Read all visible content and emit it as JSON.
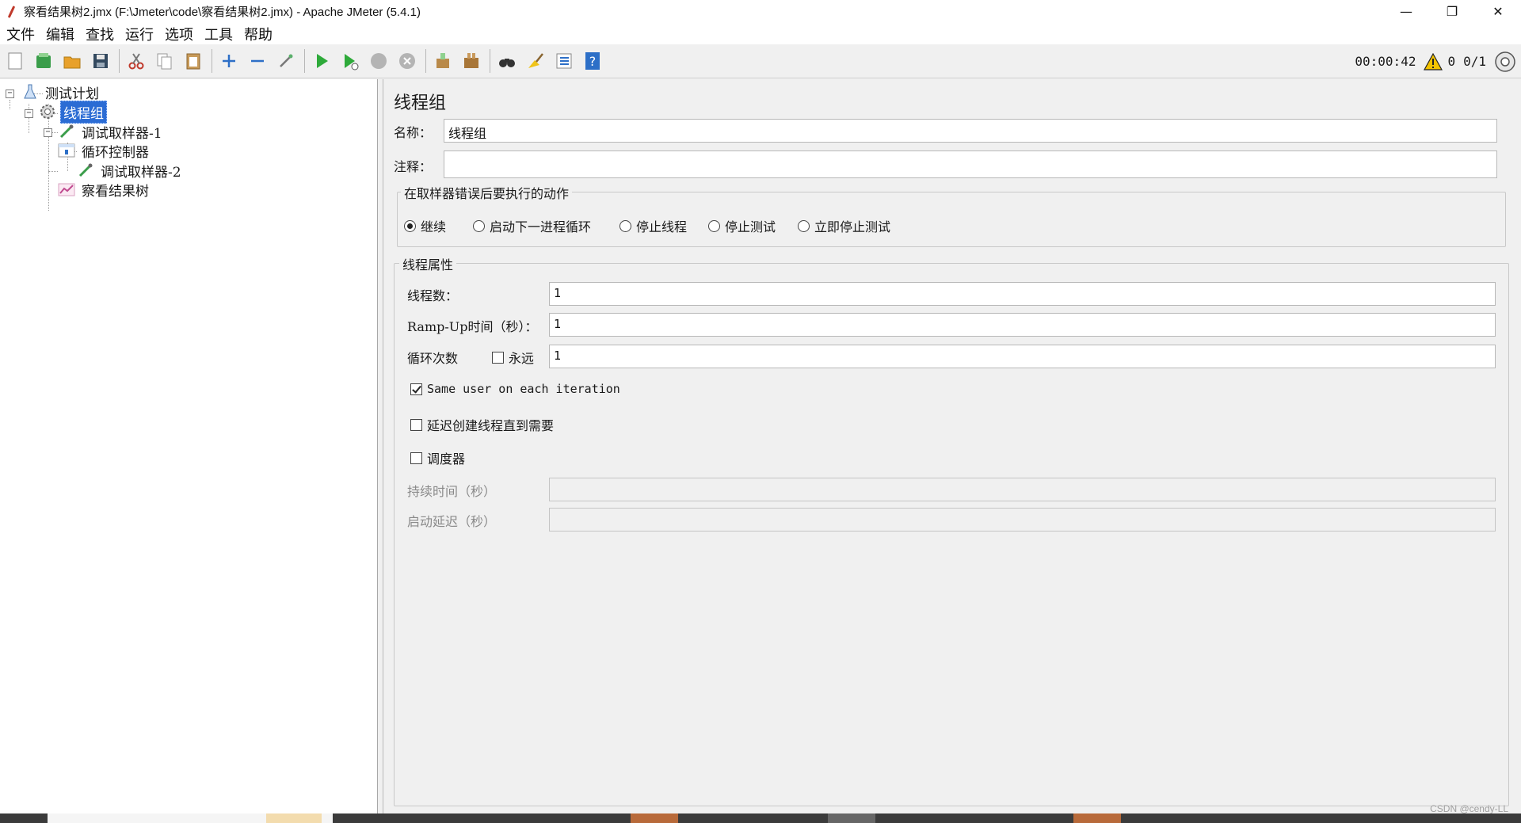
{
  "window": {
    "title": "察看结果树2.jmx (F:\\Jmeter\\code\\察看结果树2.jmx) - Apache JMeter (5.4.1)",
    "minimize": "—",
    "maximize": "❐",
    "close": "✕"
  },
  "menu": [
    "文件",
    "编辑",
    "查找",
    "运行",
    "选项",
    "工具",
    "帮助"
  ],
  "toolbar": {
    "timer": "00:00:42",
    "warnings": "0",
    "threads": "0/1"
  },
  "tree": {
    "root": "测试计划",
    "thread_group": "线程组",
    "sampler1": "调试取样器-1",
    "loop_controller": "循环控制器",
    "sampler2": "调试取样器-2",
    "results_tree": "察看结果树"
  },
  "panel": {
    "title": "线程组",
    "name_label": "名称：",
    "name_value": "线程组",
    "comment_label": "注释：",
    "comment_value": "",
    "error_group": "在取样器错误后要执行的动作",
    "error_actions": [
      "继续",
      "启动下一进程循环",
      "停止线程",
      "停止测试",
      "立即停止测试"
    ],
    "selected_action": "继续",
    "thread_props": "线程属性",
    "threads_label": "线程数：",
    "threads_value": "1",
    "rampup_label": "Ramp-Up时间（秒）：",
    "rampup_value": "1",
    "loop_label": "循环次数",
    "forever_label": "永远",
    "loop_value": "1",
    "same_user_label": "Same user on each iteration",
    "delay_label": "延迟创建线程直到需要",
    "scheduler_label": "调度器",
    "duration_label": "持续时间（秒）",
    "duration_value": "",
    "startup_delay_label": "启动延迟（秒）",
    "startup_delay_value": ""
  },
  "watermark": "CSDN @cendy-LL",
  "colors": {
    "selection": "#2b6cd4",
    "run_green": "#2eaa3a",
    "help_blue": "#2d6fc7"
  }
}
